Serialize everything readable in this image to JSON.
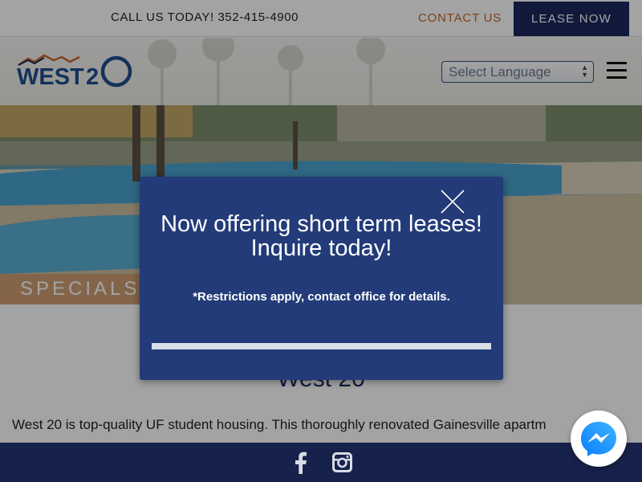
{
  "topbar": {
    "phone": "CALL US TODAY! 352-415-4900",
    "contact_label": "CONTACT US",
    "lease_label": "LEASE NOW"
  },
  "header": {
    "logo_text": "WEST20",
    "language_select": "Select Language",
    "menu_icon": "hamburger-menu-icon"
  },
  "hero": {
    "specials_label": "SPECIALS"
  },
  "content": {
    "title": "West 20",
    "intro": "West 20 is top-quality UF student housing.  This thoroughly renovated Gainesville apartm"
  },
  "modal": {
    "headline_line1": "Now offering short term leases!",
    "headline_line2": "Inquire today!",
    "note": "*Restrictions apply, contact office for details.",
    "close_icon": "close-icon",
    "progress": 1.0
  },
  "footer": {
    "icons": [
      "facebook-icon",
      "instagram-icon"
    ]
  },
  "chat": {
    "icon": "messenger-icon"
  },
  "colors": {
    "navy": "#1b2a5e",
    "modal_blue": "#233b78",
    "accent_orange": "#c7682c"
  }
}
